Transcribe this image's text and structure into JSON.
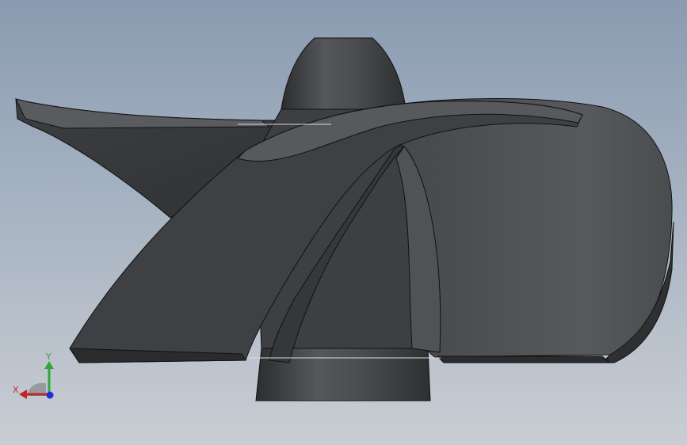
{
  "viewport": {
    "background_top": "#8a9bb1",
    "background_bottom": "#c9cdd3"
  },
  "model": {
    "name": "propeller",
    "body_color": "#4a4c4f",
    "edge_color": "#111111"
  },
  "triad": {
    "x_label": "X",
    "y_label": "Y",
    "x_color": "#c0262a",
    "y_color": "#2fa63a",
    "z_color": "#1d2fd6"
  }
}
